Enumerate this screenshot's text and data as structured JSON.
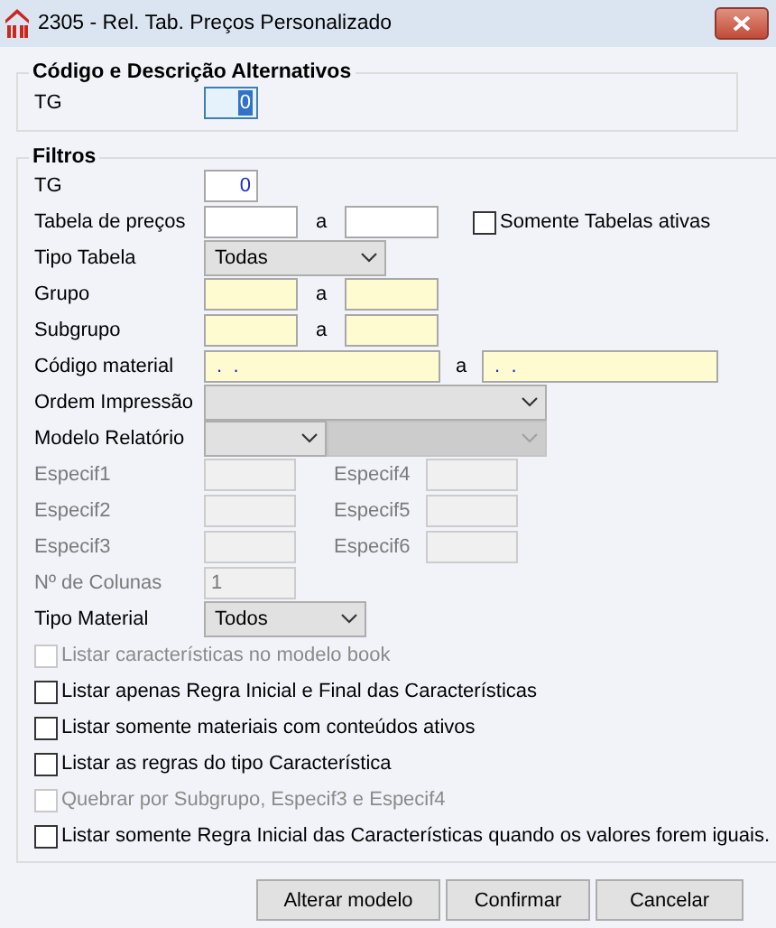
{
  "window": {
    "title": "2305 - Rel. Tab. Preços Personalizado"
  },
  "alt_group": {
    "title": "Código e Descrição Alternativos",
    "label": "TG",
    "value": "0",
    "focused": true
  },
  "filters": {
    "title": "Filtros",
    "tg": {
      "label": "TG",
      "value": "0"
    },
    "tabela_precos": {
      "label": "Tabela de preços",
      "separator": "a",
      "highlighted": false,
      "checkbox": {
        "label": "Somente Tabelas ativas",
        "checked": false
      }
    },
    "tipo_tabela": {
      "label": "Tipo Tabela",
      "value": "Todas"
    },
    "grupo": {
      "label": "Grupo",
      "separator": "a",
      "highlighted": true
    },
    "subgrupo": {
      "label": "Subgrupo",
      "separator": "a",
      "highlighted": true
    },
    "codigo_material": {
      "label": "Código material",
      "separator": "a",
      "from": " .  .",
      "to": " .  .",
      "highlighted": true
    },
    "ordem_impressao": {
      "label": "Ordem Impressão"
    },
    "modelo_relatorio": {
      "label": "Modelo Relatório",
      "second_disabled": true
    },
    "especif": [
      {
        "label": "Especif1",
        "disabled": true
      },
      {
        "label": "Especif2",
        "disabled": true
      },
      {
        "label": "Especif3",
        "disabled": true
      },
      {
        "label": "Especif4",
        "disabled": true
      },
      {
        "label": "Especif5",
        "disabled": true
      },
      {
        "label": "Especif6",
        "disabled": true
      }
    ],
    "colunas": {
      "label": "Nº de Colunas",
      "value": "1",
      "disabled": true
    },
    "tipo_material": {
      "label": "Tipo Material",
      "value": "Todos"
    },
    "options": [
      {
        "label": "Listar características no modelo book",
        "checked": false,
        "disabled": true
      },
      {
        "label": "Listar apenas Regra Inicial e Final das Características",
        "checked": false,
        "disabled": false
      },
      {
        "label": "Listar somente materiais com conteúdos ativos",
        "checked": false,
        "disabled": false
      },
      {
        "label": "Listar as regras do tipo Característica",
        "checked": false,
        "disabled": false
      },
      {
        "label": "Quebrar por Subgrupo, Especif3 e Especif4",
        "checked": false,
        "disabled": true
      },
      {
        "label": "Listar somente Regra Inicial das Características quando os valores forem iguais.",
        "checked": false,
        "disabled": false
      }
    ]
  },
  "buttons": [
    {
      "label": "Alterar modelo"
    },
    {
      "label": "Confirmar"
    },
    {
      "label": "Cancelar"
    }
  ]
}
